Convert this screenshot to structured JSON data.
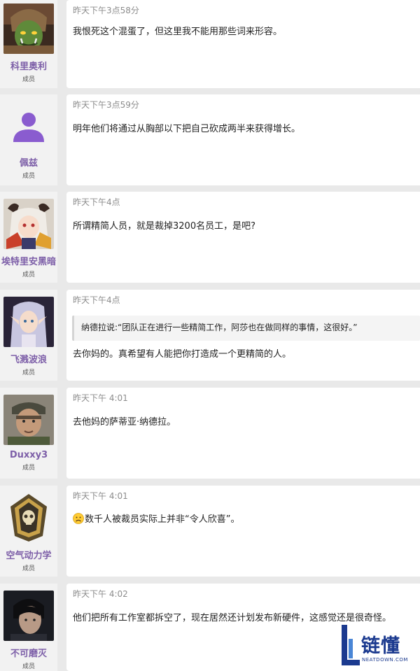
{
  "posts": [
    {
      "username": "科里奥利",
      "role": "成员",
      "avatar": "orc-warrior-avatar",
      "timestamp": "昨天下午3点58分",
      "text": "我恨死这个混蛋了，但这里我不能用那些词来形容。"
    },
    {
      "username": "佩兹",
      "role": "成员",
      "avatar": "default-person-icon",
      "timestamp": "昨天下午3点59分",
      "text": "明年他们将通过从胸部以下把自己砍成两半来获得增长。"
    },
    {
      "username": "埃特里安黑暗",
      "role": "成员",
      "avatar": "anime-horned-girl-avatar",
      "timestamp": "昨天下午4点",
      "text": "所谓精简人员，就是裁掉3200名员工，是吧?"
    },
    {
      "username": "飞溅波浪",
      "role": "成员",
      "avatar": "elf-girl-avatar",
      "timestamp": "昨天下午4点",
      "quote": "纳德拉说:“团队正在进行一些精简工作，阿莎也在做同样的事情，这很好。”",
      "text": "去你妈的。真希望有人能把你打造成一个更精简的人。"
    },
    {
      "username": "Duxxy3",
      "role": "成员",
      "avatar": "soldier-avatar",
      "timestamp": "昨天下午 4:01",
      "text": "去他妈的萨蒂亚·纳德拉。"
    },
    {
      "username": "空气动力学",
      "role": "成员",
      "avatar": "skull-emblem-avatar",
      "timestamp": "昨天下午 4:01",
      "emoji": "sad-face-emoji",
      "text": "数千人被裁员实际上并非“令人欣喜”。"
    },
    {
      "username": "不可磨灭",
      "role": "成员",
      "avatar": "dark-hair-man-avatar",
      "timestamp": "昨天下午 4:02",
      "text": "他们把所有工作室都拆空了，现在居然还计划发布新硬件，这感觉还是很奇怪。"
    }
  ],
  "watermark": {
    "logo_text": "链懂",
    "domain": "NEATDOWN.COM",
    "color": "#1b3a8f"
  },
  "colors": {
    "username": "#7d5fa8",
    "timestamp": "#8c8c8c",
    "background": "#e9e9e9"
  }
}
